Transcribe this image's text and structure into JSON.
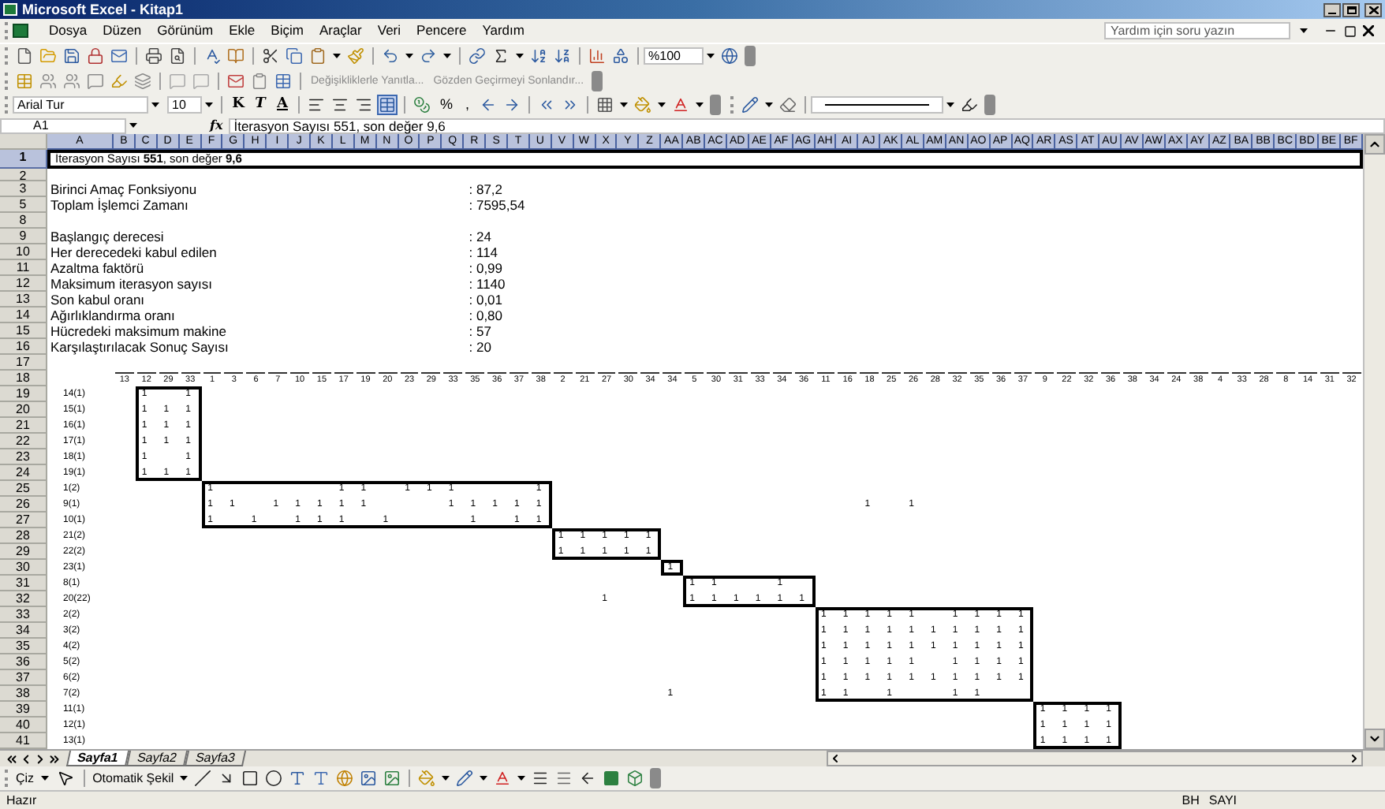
{
  "window": {
    "title": "Microsoft Excel - Kitap1"
  },
  "menu": [
    "Dosya",
    "Düzen",
    "Görünüm",
    "Ekle",
    "Biçim",
    "Araçlar",
    "Veri",
    "Pencere",
    "Yardım"
  ],
  "help_box": {
    "placeholder": "Yardım için soru yazın"
  },
  "standard_toolbar": {
    "zoom": "%100"
  },
  "reviewing_toolbar": {
    "buttons": [
      "Değişikliklerle Yanıtla...",
      "Gözden Geçirmeyi Sonlandır..."
    ]
  },
  "formatting_toolbar": {
    "font": "Arial Tur",
    "size": "10",
    "style_buttons": [
      {
        "label": "K",
        "kind": "bold"
      },
      {
        "label": "T",
        "kind": "italic"
      },
      {
        "label": "A",
        "kind": "underline"
      }
    ],
    "number_buttons": [
      "%",
      ","
    ]
  },
  "formula_bar": {
    "name_box": "A1",
    "function_label": "fx",
    "formula": "İterasyon Sayısı 551, son değer 9,6"
  },
  "sheet": {
    "column_headers": [
      {
        "label": "A",
        "selected": true
      },
      {
        "label": "B",
        "selected": true
      },
      {
        "label": "C",
        "selected": true
      },
      {
        "label": "D",
        "selected": true
      },
      {
        "label": "E",
        "selected": true
      },
      {
        "label": "F",
        "selected": true
      },
      {
        "label": "G",
        "selected": true
      },
      {
        "label": "H",
        "selected": true
      },
      {
        "label": "I",
        "selected": true
      },
      {
        "label": "J",
        "selected": true
      },
      {
        "label": "K",
        "selected": true
      },
      {
        "label": "L",
        "selected": true
      },
      {
        "label": "M",
        "selected": true
      },
      {
        "label": "N",
        "selected": true
      },
      {
        "label": "O",
        "selected": true
      },
      {
        "label": "P",
        "selected": true
      },
      {
        "label": "Q",
        "selected": true
      },
      {
        "label": "R",
        "selected": true
      },
      {
        "label": "S",
        "selected": true
      },
      {
        "label": "T",
        "selected": true
      },
      {
        "label": "U",
        "selected": true
      },
      {
        "label": "V",
        "selected": true
      },
      {
        "label": "W",
        "selected": true
      },
      {
        "label": "X",
        "selected": true
      },
      {
        "label": "Y",
        "selected": true
      },
      {
        "label": "Z",
        "selected": true
      },
      {
        "label": "AA",
        "selected": true
      },
      {
        "label": "AB",
        "selected": true
      },
      {
        "label": "AC",
        "selected": true
      },
      {
        "label": "AD",
        "selected": true
      },
      {
        "label": "AE",
        "selected": true
      },
      {
        "label": "AF",
        "selected": true
      },
      {
        "label": "AG",
        "selected": true
      },
      {
        "label": "AH",
        "selected": true
      },
      {
        "label": "AI",
        "selected": true
      },
      {
        "label": "AJ",
        "selected": true
      },
      {
        "label": "AK",
        "selected": true
      },
      {
        "label": "AL",
        "selected": true
      },
      {
        "label": "AM",
        "selected": true
      },
      {
        "label": "AN",
        "selected": true
      },
      {
        "label": "AO",
        "selected": true
      },
      {
        "label": "AP",
        "selected": true
      },
      {
        "label": "AQ",
        "selected": true
      },
      {
        "label": "AR",
        "selected": true
      },
      {
        "label": "AS",
        "selected": true
      },
      {
        "label": "AT",
        "selected": true
      },
      {
        "label": "AU",
        "selected": true
      },
      {
        "label": "AV",
        "selected": true
      },
      {
        "label": "AW",
        "selected": true
      },
      {
        "label": "AX",
        "selected": true
      },
      {
        "label": "AY",
        "selected": true
      },
      {
        "label": "AZ",
        "selected": true
      },
      {
        "label": "BA",
        "selected": true
      },
      {
        "label": "BB",
        "selected": true
      },
      {
        "label": "BC",
        "selected": true
      },
      {
        "label": "BD",
        "selected": true
      },
      {
        "label": "BE",
        "selected": true
      },
      {
        "label": "BF",
        "selected": true
      }
    ],
    "rows": [
      {
        "number": "1",
        "kind": "title",
        "text": "İterasyon Sayısı **551**, son değer **9,6**",
        "selected": true
      },
      {
        "number": "2",
        "kind": "blank",
        "selected": false
      },
      {
        "number": "3",
        "kind": "param",
        "label": "Birinci Amaç Fonksiyonu",
        "value": ": 87,2",
        "selected": false
      },
      {
        "number": "5",
        "kind": "param",
        "label": "Toplam İşlemci Zamanı",
        "value": ": 7595,54",
        "selected": false
      },
      {
        "number": "8",
        "kind": "blank",
        "selected": false
      },
      {
        "number": "9",
        "kind": "param",
        "label": "Başlangıç derecesi",
        "value": ": 24",
        "selected": false
      },
      {
        "number": "10",
        "kind": "param",
        "label": "Her derecedeki kabul edilen",
        "value": ": 114",
        "selected": false
      },
      {
        "number": "11",
        "kind": "param",
        "label": "Azaltma faktörü",
        "value": ": 0,99",
        "selected": false
      },
      {
        "number": "12",
        "kind": "param",
        "label": "Maksimum iterasyon sayısı",
        "value": ": 1140",
        "selected": false
      },
      {
        "number": "13",
        "kind": "param",
        "label": "Son kabul oranı",
        "value": ": 0,01",
        "selected": false
      },
      {
        "number": "14",
        "kind": "param",
        "label": "Ağırlıklandırma oranı",
        "value": ": 0,80",
        "selected": false
      },
      {
        "number": "15",
        "kind": "param",
        "label": "Hücredeki maksimum makine",
        "value": ": 57",
        "selected": false
      },
      {
        "number": "16",
        "kind": "param",
        "label": "Karşılaştırılacak Sonuç Sayısı",
        "value": ": 20",
        "selected": false
      },
      {
        "number": "17",
        "kind": "blank",
        "selected": false
      }
    ],
    "matrix": {
      "header_row_number": "18",
      "column_groups": [
        {
          "boxed": false,
          "headers": [
            "13"
          ]
        },
        {
          "boxed": true,
          "headers": [
            "12",
            "29",
            "33"
          ]
        },
        {
          "boxed": true,
          "headers": [
            "1",
            "3",
            "6",
            "7",
            "10",
            "15",
            "17",
            "19",
            "20",
            "23",
            "29",
            "33",
            "35",
            "36",
            "37",
            "38"
          ]
        },
        {
          "boxed": true,
          "headers": [
            "2",
            "21",
            "27",
            "30",
            "34"
          ]
        },
        {
          "boxed": true,
          "headers": [
            "34"
          ]
        },
        {
          "boxed": true,
          "headers": [
            "5",
            "30",
            "31",
            "33",
            "34",
            "36"
          ]
        },
        {
          "boxed": true,
          "headers": [
            "11",
            "16",
            "18",
            "25",
            "26",
            "28",
            "32",
            "35",
            "36",
            "37"
          ]
        },
        {
          "boxed": true,
          "headers": [
            "9",
            "22",
            "32",
            "36"
          ]
        },
        {
          "boxed": false,
          "headers": [
            "38",
            "34",
            "24",
            "38",
            "4",
            "33",
            "28",
            "8",
            "14",
            "31",
            "32"
          ]
        }
      ],
      "row_groups": [
        {
          "rows": [
            {
              "number": "19",
              "label": "14(1)",
              "cells": [
                null,
                "1",
                null,
                "1"
              ]
            },
            {
              "number": "20",
              "label": "15(1)",
              "cells": [
                null,
                "1",
                "1",
                "1"
              ]
            },
            {
              "number": "21",
              "label": "16(1)",
              "cells": [
                null,
                "1",
                "1",
                "1"
              ]
            },
            {
              "number": "22",
              "label": "17(1)",
              "cells": [
                null,
                "1",
                "1",
                "1"
              ]
            },
            {
              "number": "23",
              "label": "18(1)",
              "cells": [
                null,
                "1",
                null,
                "1"
              ]
            },
            {
              "number": "24",
              "label": "19(1)",
              "cells": [
                null,
                "1",
                "1",
                "1"
              ]
            }
          ]
        },
        {
          "rows": [
            {
              "number": "25",
              "label": "1(2)",
              "cells": [
                null,
                null,
                null,
                null,
                "1",
                null,
                null,
                null,
                null,
                null,
                "1",
                "1",
                null,
                "1",
                "1",
                "1",
                null,
                null,
                null,
                "1"
              ]
            },
            {
              "number": "26",
              "label": "9(1)",
              "cells": [
                null,
                null,
                null,
                null,
                "1",
                "1",
                null,
                "1",
                "1",
                "1",
                "1",
                "1",
                null,
                null,
                null,
                "1",
                "1",
                "1",
                "1",
                "1",
                null,
                null,
                null,
                null,
                null,
                null,
                null,
                null,
                null,
                null,
                null,
                null,
                null,
                null,
                "1",
                null,
                "1"
              ]
            },
            {
              "number": "27",
              "label": "10(1)",
              "cells": [
                null,
                null,
                null,
                null,
                "1",
                null,
                "1",
                null,
                "1",
                "1",
                "1",
                null,
                "1",
                null,
                null,
                null,
                "1",
                null,
                "1",
                "1"
              ]
            }
          ]
        },
        {
          "rows": [
            {
              "number": "28",
              "label": "21(2)",
              "cells": [
                null,
                null,
                null,
                null,
                null,
                null,
                null,
                null,
                null,
                null,
                null,
                null,
                null,
                null,
                null,
                null,
                null,
                null,
                null,
                null,
                "1",
                "1",
                "1",
                "1",
                "1"
              ]
            },
            {
              "number": "29",
              "label": "22(2)",
              "cells": [
                null,
                null,
                null,
                null,
                null,
                null,
                null,
                null,
                null,
                null,
                null,
                null,
                null,
                null,
                null,
                null,
                null,
                null,
                null,
                null,
                "1",
                "1",
                "1",
                "1",
                "1"
              ]
            }
          ]
        },
        {
          "rows": [
            {
              "number": "30",
              "label": "23(1)",
              "cells": [
                null,
                null,
                null,
                null,
                null,
                null,
                null,
                null,
                null,
                null,
                null,
                null,
                null,
                null,
                null,
                null,
                null,
                null,
                null,
                null,
                null,
                null,
                null,
                null,
                null,
                "1"
              ]
            }
          ]
        },
        {
          "rows": [
            {
              "number": "31",
              "label": "8(1)",
              "cells": [
                null,
                null,
                null,
                null,
                null,
                null,
                null,
                null,
                null,
                null,
                null,
                null,
                null,
                null,
                null,
                null,
                null,
                null,
                null,
                null,
                null,
                null,
                null,
                null,
                null,
                null,
                "1",
                "1",
                null,
                null,
                "1"
              ]
            },
            {
              "number": "32",
              "label": "20(22)",
              "cells": [
                null,
                null,
                null,
                null,
                null,
                null,
                null,
                null,
                null,
                null,
                null,
                null,
                null,
                null,
                null,
                null,
                null,
                null,
                null,
                null,
                null,
                null,
                "1",
                null,
                null,
                null,
                "1",
                "1",
                "1",
                "1",
                "1",
                "1"
              ]
            }
          ]
        },
        {
          "rows": [
            {
              "number": "33",
              "label": "2(2)",
              "cells": [
                null,
                null,
                null,
                null,
                null,
                null,
                null,
                null,
                null,
                null,
                null,
                null,
                null,
                null,
                null,
                null,
                null,
                null,
                null,
                null,
                null,
                null,
                null,
                null,
                null,
                null,
                null,
                null,
                null,
                null,
                null,
                null,
                "1",
                "1",
                "1",
                "1",
                "1",
                null,
                "1",
                "1",
                "1",
                "1"
              ]
            },
            {
              "number": "34",
              "label": "3(2)",
              "cells": [
                null,
                null,
                null,
                null,
                null,
                null,
                null,
                null,
                null,
                null,
                null,
                null,
                null,
                null,
                null,
                null,
                null,
                null,
                null,
                null,
                null,
                null,
                null,
                null,
                null,
                null,
                null,
                null,
                null,
                null,
                null,
                null,
                "1",
                "1",
                "1",
                "1",
                "1",
                "1",
                "1",
                "1",
                "1",
                "1"
              ]
            },
            {
              "number": "35",
              "label": "4(2)",
              "cells": [
                null,
                null,
                null,
                null,
                null,
                null,
                null,
                null,
                null,
                null,
                null,
                null,
                null,
                null,
                null,
                null,
                null,
                null,
                null,
                null,
                null,
                null,
                null,
                null,
                null,
                null,
                null,
                null,
                null,
                null,
                null,
                null,
                "1",
                "1",
                "1",
                "1",
                "1",
                "1",
                "1",
                "1",
                "1",
                "1"
              ]
            },
            {
              "number": "36",
              "label": "5(2)",
              "cells": [
                null,
                null,
                null,
                null,
                null,
                null,
                null,
                null,
                null,
                null,
                null,
                null,
                null,
                null,
                null,
                null,
                null,
                null,
                null,
                null,
                null,
                null,
                null,
                null,
                null,
                null,
                null,
                null,
                null,
                null,
                null,
                null,
                "1",
                "1",
                "1",
                "1",
                "1",
                null,
                "1",
                "1",
                "1",
                "1"
              ]
            },
            {
              "number": "37",
              "label": "6(2)",
              "cells": [
                null,
                null,
                null,
                null,
                null,
                null,
                null,
                null,
                null,
                null,
                null,
                null,
                null,
                null,
                null,
                null,
                null,
                null,
                null,
                null,
                null,
                null,
                null,
                null,
                null,
                null,
                null,
                null,
                null,
                null,
                null,
                null,
                "1",
                "1",
                "1",
                "1",
                "1",
                "1",
                "1",
                "1",
                "1",
                "1"
              ]
            },
            {
              "number": "38",
              "label": "7(2)",
              "cells": [
                null,
                null,
                null,
                null,
                null,
                null,
                null,
                null,
                null,
                null,
                null,
                null,
                null,
                null,
                null,
                null,
                null,
                null,
                null,
                null,
                null,
                null,
                null,
                null,
                null,
                "1",
                null,
                null,
                null,
                null,
                null,
                null,
                "1",
                "1",
                null,
                "1",
                null,
                null,
                "1",
                "1"
              ]
            }
          ]
        },
        {
          "rows": [
            {
              "number": "39",
              "label": "11(1)",
              "cells": [
                null,
                null,
                null,
                null,
                null,
                null,
                null,
                null,
                null,
                null,
                null,
                null,
                null,
                null,
                null,
                null,
                null,
                null,
                null,
                null,
                null,
                null,
                null,
                null,
                null,
                null,
                null,
                null,
                null,
                null,
                null,
                null,
                null,
                null,
                null,
                null,
                null,
                null,
                null,
                null,
                null,
                null,
                "1",
                "1",
                "1",
                "1"
              ]
            },
            {
              "number": "40",
              "label": "12(1)",
              "cells": [
                null,
                null,
                null,
                null,
                null,
                null,
                null,
                null,
                null,
                null,
                null,
                null,
                null,
                null,
                null,
                null,
                null,
                null,
                null,
                null,
                null,
                null,
                null,
                null,
                null,
                null,
                null,
                null,
                null,
                null,
                null,
                null,
                null,
                null,
                null,
                null,
                null,
                null,
                null,
                null,
                null,
                null,
                "1",
                "1",
                "1",
                "1"
              ]
            },
            {
              "number": "41",
              "label": "13(1)",
              "cells": [
                null,
                null,
                null,
                null,
                null,
                null,
                null,
                null,
                null,
                null,
                null,
                null,
                null,
                null,
                null,
                null,
                null,
                null,
                null,
                null,
                null,
                null,
                null,
                null,
                null,
                null,
                null,
                null,
                null,
                null,
                null,
                null,
                null,
                null,
                null,
                null,
                null,
                null,
                null,
                null,
                null,
                null,
                "1",
                "1",
                "1",
                "1"
              ]
            }
          ]
        }
      ]
    }
  },
  "sheet_tabs": [
    {
      "label": "Sayfa1",
      "selected": true
    },
    {
      "label": "Sayfa2",
      "selected": false
    },
    {
      "label": "Sayfa3",
      "selected": false
    }
  ],
  "drawing_toolbar": {
    "buttons": [
      "Çiz",
      "Otomatik Şekil"
    ]
  },
  "status_bar": {
    "text": "Hazır",
    "indicators": [
      "BH",
      "SAYI"
    ]
  }
}
